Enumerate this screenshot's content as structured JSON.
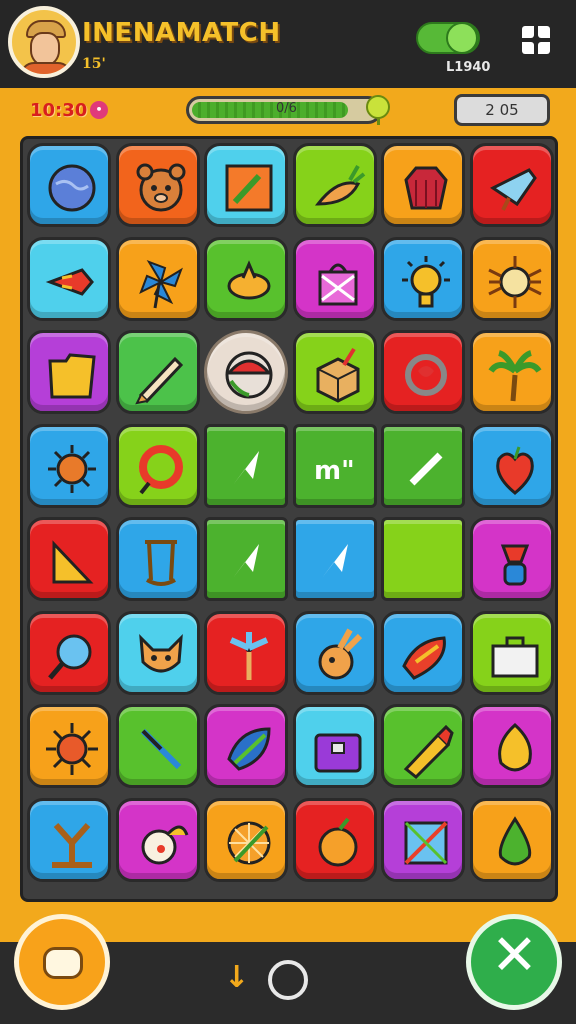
{
  "header": {
    "title": "INENAMATCH",
    "level": "15'",
    "coins": "L1940",
    "toggle_state": "on"
  },
  "status": {
    "timer": "10:30",
    "timer_icon": "alarm-icon",
    "progress_text": "0/6",
    "progress_fraction": 0.85,
    "score": "2 05"
  },
  "board": {
    "tiles": [
      {
        "name": "globe",
        "color": "#2fa6e8"
      },
      {
        "name": "bear-face",
        "color": "#f2641c"
      },
      {
        "name": "picture-frame",
        "color": "#4fd0ec"
      },
      {
        "name": "carrot",
        "color": "#86d21a"
      },
      {
        "name": "red-gem",
        "color": "#f7a11a"
      },
      {
        "name": "blue-crystal",
        "color": "#e52222"
      },
      {
        "name": "rocket",
        "color": "#4fd0ec"
      },
      {
        "name": "pinwheel",
        "color": "#f7a11a"
      },
      {
        "name": "bird",
        "color": "#58c12d"
      },
      {
        "name": "gift-bag",
        "color": "#d434c8"
      },
      {
        "name": "sun-face",
        "color": "#2fa6e8"
      },
      {
        "name": "bug",
        "color": "#f7a11a"
      },
      {
        "name": "folder",
        "color": "#b53fd8"
      },
      {
        "name": "pencil",
        "color": "#4cc24a"
      },
      {
        "name": "ball",
        "color": "selected"
      },
      {
        "name": "box",
        "color": "#86d21a"
      },
      {
        "name": "ring",
        "color": "#e52222"
      },
      {
        "name": "palm-tree",
        "color": "#f7a11a"
      },
      {
        "name": "sun-badge",
        "color": "#2fa6e8"
      },
      {
        "name": "lifebuoy",
        "color": "#86d21a"
      },
      {
        "name": "arrow-a",
        "color": "#4cb22e"
      },
      {
        "name": "text-tile",
        "color": "#4cb22e"
      },
      {
        "name": "slash-tile",
        "color": "#4cb22e"
      },
      {
        "name": "heart-fruit",
        "color": "#2fa6e8"
      },
      {
        "name": "cheese",
        "color": "#e52222"
      },
      {
        "name": "swing",
        "color": "#2fa6e8"
      },
      {
        "name": "arrow-b",
        "color": "#4cb22e"
      },
      {
        "name": "arrow-c",
        "color": "#2fa6e8"
      },
      {
        "name": "blank",
        "color": "#86d21a"
      },
      {
        "name": "lamp",
        "color": "#d434c8"
      },
      {
        "name": "magnifier",
        "color": "#e52222"
      },
      {
        "name": "fox-face",
        "color": "#4fd0ec"
      },
      {
        "name": "fan",
        "color": "#e52222"
      },
      {
        "name": "bunny",
        "color": "#2fa6e8"
      },
      {
        "name": "chili",
        "color": "#2fa6e8"
      },
      {
        "name": "briefcase",
        "color": "#86d21a"
      },
      {
        "name": "sun-star",
        "color": "#f7a11a"
      },
      {
        "name": "sword",
        "color": "#58c12d"
      },
      {
        "name": "leaf-gem",
        "color": "#d434c8"
      },
      {
        "name": "bag",
        "color": "#4fd0ec"
      },
      {
        "name": "crayon",
        "color": "#58c12d"
      },
      {
        "name": "lemon",
        "color": "#d434c8"
      },
      {
        "name": "catapult",
        "color": "#2fa6e8"
      },
      {
        "name": "clown",
        "color": "#d434c8"
      },
      {
        "name": "orange-slice",
        "color": "#f7a11a"
      },
      {
        "name": "apple",
        "color": "#e52222"
      },
      {
        "name": "kite",
        "color": "#b53fd8"
      },
      {
        "name": "green-drop",
        "color": "#f7a11a"
      }
    ],
    "highlighted_text": "m\""
  },
  "bottom": {
    "chat_icon": "chat-bubble-icon",
    "down_icon": "down-arrow-icon",
    "ring_icon": "ring-icon",
    "close_icon": "close-x-icon"
  }
}
